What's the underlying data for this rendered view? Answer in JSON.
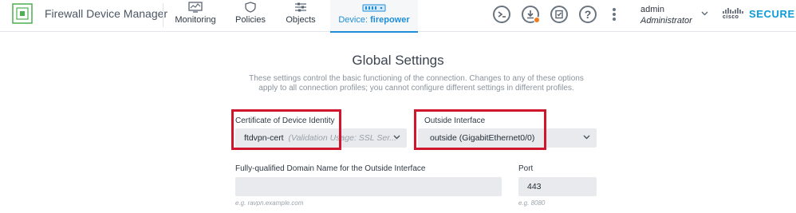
{
  "app": {
    "title": "Firewall Device Manager"
  },
  "nav": {
    "tabs": [
      {
        "label": "Monitoring",
        "icon": "monitoring-icon"
      },
      {
        "label": "Policies",
        "icon": "policies-icon"
      },
      {
        "label": "Objects",
        "icon": "objects-icon"
      }
    ],
    "device_tab": {
      "prefix": "Device: ",
      "name": "firepower",
      "icon": "device-icon"
    }
  },
  "user": {
    "name": "admin",
    "role": "Administrator"
  },
  "brand": {
    "cisco": "cisco",
    "product": "SECURE"
  },
  "colors": {
    "accent": "#1f8ed6",
    "highlight": "#d0162d",
    "notification": "#f07b1c",
    "brand": "#0c9bd7"
  },
  "page": {
    "title": "Global Settings",
    "description": "These settings control the basic functioning of the connection. Changes to any of these options apply to all connection profiles; you cannot configure different settings in different profiles."
  },
  "form": {
    "certificate": {
      "label": "Certificate of Device Identity",
      "value": "ftdvpn-cert",
      "hint": "(Validation Usage: SSL Ser..."
    },
    "outside_interface": {
      "label": "Outside Interface",
      "value": "outside (GigabitEthernet0/0)"
    },
    "fqdn": {
      "label": "Fully-qualified Domain Name for the Outside Interface",
      "value": "",
      "helper": "e.g. ravpn.example.com"
    },
    "port": {
      "label": "Port",
      "value": "443",
      "helper": "e.g. 8080"
    }
  }
}
